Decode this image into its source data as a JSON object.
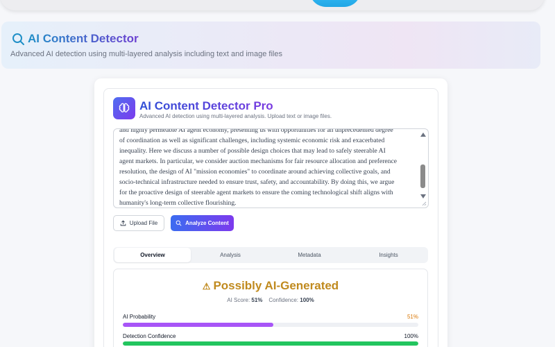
{
  "header": {
    "title": "AI Content Detector",
    "subtitle": "Advanced AI detection using multi-layered analysis including text and image files"
  },
  "app": {
    "title": "AI Content Detector Pro",
    "subtitle": "Advanced AI detection using multi-layered analysis. Upload text or image files."
  },
  "textarea": {
    "lines": [
      "and highly permeable AI agent economy, presenting us with opportunities for an unprecedented degree",
      "of coordination as well as significant challenges, including systemic economic risk and exacerbated",
      "inequality. Here we discuss a number of possible design choices that may lead to safely steerable AI",
      "agent markets. In particular, we consider auction mechanisms for fair resource allocation and preference",
      "resolution, the design of AI \"mission economies\" to coordinate around achieving collective goals, and",
      "socio-technical infrastructure needed to ensure trust, safety, and accountability. By doing this, we argue",
      "for the proactive design of steerable agent markets to ensure the coming technological shift aligns with",
      "humanity's long-term collective flourishing."
    ]
  },
  "buttons": {
    "upload": "Upload File",
    "analyze": "Analyze Content"
  },
  "tabs": [
    "Overview",
    "Analysis",
    "Metadata",
    "Insights"
  ],
  "result": {
    "verdict": "Possibly AI-Generated",
    "ai_score_label": "AI Score:",
    "ai_score": "51%",
    "confidence_label": "Confidence:",
    "confidence": "100%",
    "metrics": [
      {
        "label": "AI Probability",
        "value": "51%",
        "fraction": 0.51,
        "color": "#a855f7",
        "value_color": "#d97706"
      },
      {
        "label": "Detection Confidence",
        "value": "100%",
        "fraction": 1.0,
        "color": "#22c55e",
        "value_color": "#111827"
      }
    ]
  },
  "colors": {
    "accent": "#4f46e5",
    "warning": "#c08a1e"
  }
}
